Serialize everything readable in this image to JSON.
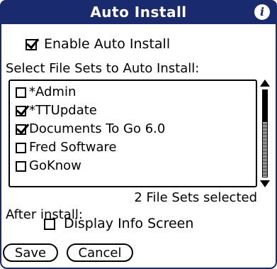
{
  "window": {
    "title": "Auto Install"
  },
  "enable": {
    "label": "Enable Auto Install",
    "checked": true
  },
  "file_sets": {
    "label": "Select File Sets to Auto Install:",
    "items": [
      {
        "label": "*Admin",
        "checked": false
      },
      {
        "label": "*TTUpdate",
        "checked": true
      },
      {
        "label": "Documents To Go 6.0",
        "checked": true
      },
      {
        "label": "Fred Software",
        "checked": false
      },
      {
        "label": "GoKnow",
        "checked": false
      }
    ],
    "selected_text": "2 File Sets selected"
  },
  "after_install": {
    "label": "After install:",
    "display_info": {
      "label": "Display Info Screen",
      "checked": false
    }
  },
  "buttons": {
    "save": "Save",
    "cancel": "Cancel"
  },
  "colors": {
    "titlebar": "#1a2a6e"
  },
  "icons": {
    "info": "info-icon"
  }
}
